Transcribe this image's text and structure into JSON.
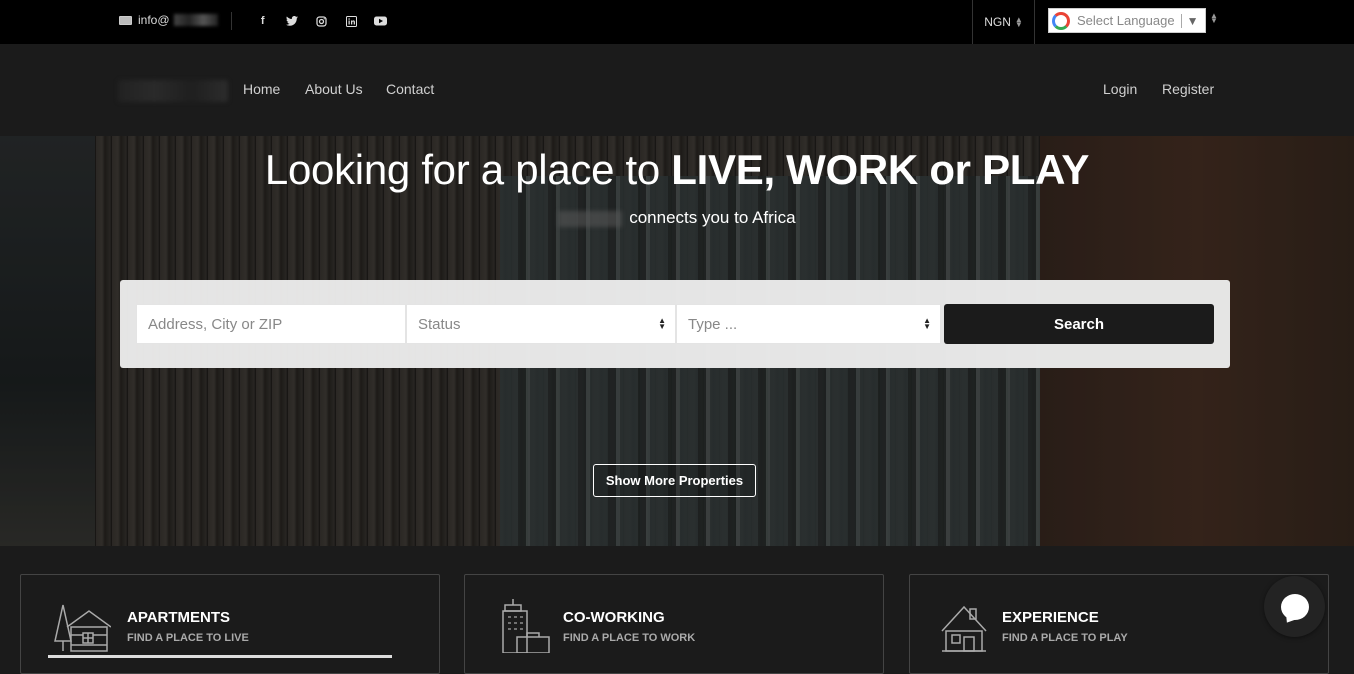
{
  "topbar": {
    "email_label": "info@",
    "social_icons": [
      "facebook-icon",
      "twitter-icon",
      "instagram-icon",
      "linkedin-icon",
      "youtube-icon"
    ],
    "social_glyphs": [
      "f",
      "t",
      "o",
      "in",
      "▶"
    ],
    "currency": "NGN",
    "language_select": "Select Language",
    "language_arrow": "▼"
  },
  "nav": {
    "links": [
      "Home",
      "About Us",
      "Contact"
    ],
    "login": "Login",
    "register": "Register"
  },
  "hero": {
    "title_prefix": "Looking for a place to ",
    "title_bold": "LIVE, WORK or PLAY",
    "subtitle": "connects you to Africa"
  },
  "search": {
    "address_placeholder": "Address, City or ZIP",
    "status_value": "Status",
    "type_value": "Type ...",
    "button_label": "Search"
  },
  "show_more_label": "Show More Properties",
  "cards": [
    {
      "title": "APARTMENTS",
      "subtitle": "FIND A PLACE TO LIVE",
      "icon": "cabin-icon"
    },
    {
      "title": "CO-WORKING",
      "subtitle": "FIND A PLACE TO WORK",
      "icon": "office-building-icon"
    },
    {
      "title": "EXPERIENCE",
      "subtitle": "FIND A PLACE TO PLAY",
      "icon": "house-icon"
    }
  ],
  "colors": {
    "topbar_bg": "#000000",
    "nav_bg": "#1b1b1b",
    "search_button_bg": "#1b1b1b",
    "search_panel_bg": "#ebebeb"
  }
}
